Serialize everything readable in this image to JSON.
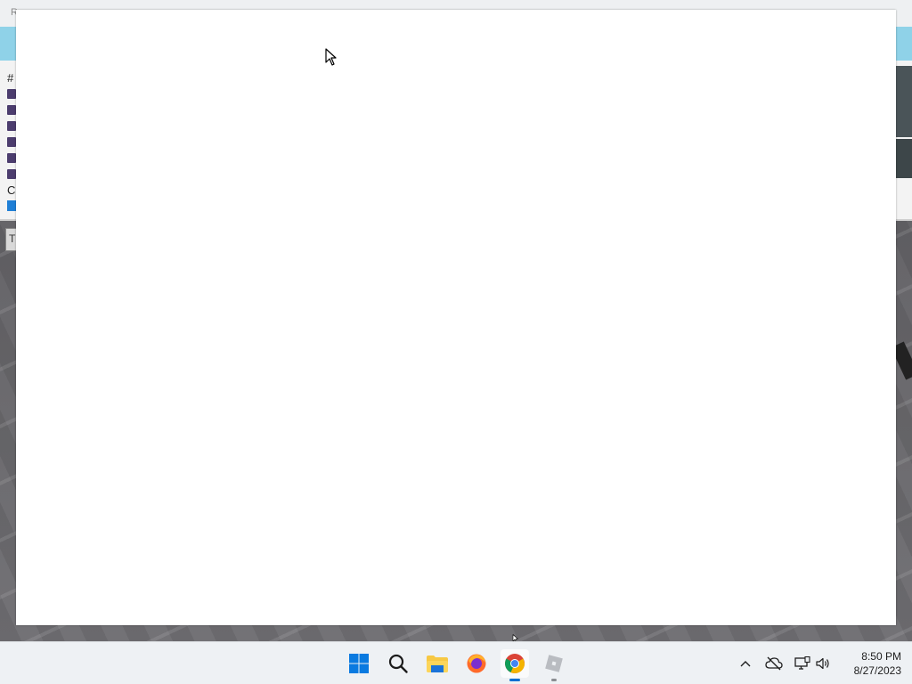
{
  "background_app": {
    "top_bar_text": "R",
    "chat_hash": "#",
    "chat_letter": "C",
    "box_letter": "T"
  },
  "taskbar": {
    "apps": [
      {
        "name": "Start",
        "icon": "windows-start-icon"
      },
      {
        "name": "Search",
        "icon": "search-icon"
      },
      {
        "name": "File Explorer",
        "icon": "folder-icon"
      },
      {
        "name": "Firefox",
        "icon": "firefox-icon"
      },
      {
        "name": "Google Chrome",
        "icon": "chrome-icon",
        "active": true
      },
      {
        "name": "Roblox",
        "icon": "roblox-icon"
      }
    ],
    "tray": {
      "icons": [
        "chevron-up-icon",
        "cloud-offline-icon",
        "network-icon",
        "volume-icon"
      ]
    },
    "clock": {
      "time": "8:50 PM",
      "date": "8/27/2023"
    }
  },
  "colors": {
    "taskbar_bg": "#eef1f4",
    "window_bg": "#ffffff",
    "accent_blue": "#0078d4"
  }
}
